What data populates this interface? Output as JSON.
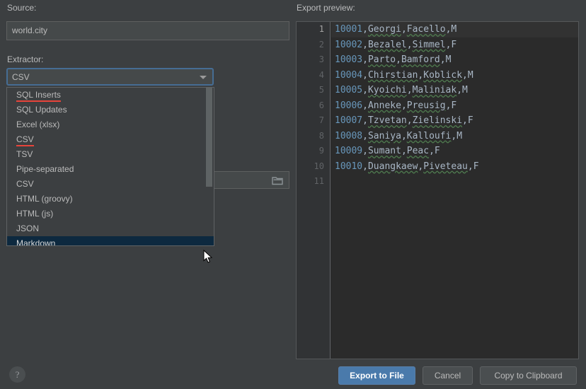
{
  "left_pane": {
    "source_label": "Source:",
    "source_value": "world.city",
    "extractor_label": "Extractor:",
    "extractor_value": "CSV",
    "output_path_value": "",
    "folder_icon": "folder-icon",
    "dropdown_arrow_icon": "chevron-down-icon"
  },
  "extractor_dropdown": {
    "items": [
      {
        "label": "SQL Inserts",
        "underlined": true,
        "selected": false
      },
      {
        "label": "SQL Updates",
        "underlined": false,
        "selected": false
      },
      {
        "label": "Excel (xlsx)",
        "underlined": false,
        "selected": false
      },
      {
        "label": "CSV",
        "underlined": true,
        "selected": false
      },
      {
        "label": "TSV",
        "underlined": false,
        "selected": false
      },
      {
        "label": "Pipe-separated",
        "underlined": false,
        "selected": false
      },
      {
        "label": "CSV",
        "underlined": false,
        "selected": false
      },
      {
        "label": "HTML (groovy)",
        "underlined": false,
        "selected": false
      },
      {
        "label": "HTML (js)",
        "underlined": false,
        "selected": false
      },
      {
        "label": "JSON",
        "underlined": false,
        "selected": false
      },
      {
        "label": "Markdown",
        "underlined": false,
        "selected": true
      }
    ]
  },
  "right_pane": {
    "preview_label": "Export preview:",
    "lines": [
      {
        "n": "1",
        "id": "10001",
        "first": "Georgi",
        "last": "Facello",
        "sex": "M"
      },
      {
        "n": "2",
        "id": "10002",
        "first": "Bezalel",
        "last": "Simmel",
        "sex": "F"
      },
      {
        "n": "3",
        "id": "10003",
        "first": "Parto",
        "last": "Bamford",
        "sex": "M"
      },
      {
        "n": "4",
        "id": "10004",
        "first": "Chirstian",
        "last": "Koblick",
        "sex": "M"
      },
      {
        "n": "5",
        "id": "10005",
        "first": "Kyoichi",
        "last": "Maliniak",
        "sex": "M"
      },
      {
        "n": "6",
        "id": "10006",
        "first": "Anneke",
        "last": "Preusig",
        "sex": "F"
      },
      {
        "n": "7",
        "id": "10007",
        "first": "Tzvetan",
        "last": "Zielinski",
        "sex": "F"
      },
      {
        "n": "8",
        "id": "10008",
        "first": "Saniya",
        "last": "Kalloufi",
        "sex": "M"
      },
      {
        "n": "9",
        "id": "10009",
        "first": "Sumant",
        "last": "Peac",
        "sex": "F"
      },
      {
        "n": "10",
        "id": "10010",
        "first": "Duangkaew",
        "last": "Piveteau",
        "sex": "F"
      },
      {
        "n": "11",
        "id": "",
        "first": "",
        "last": "",
        "sex": ""
      }
    ]
  },
  "footer": {
    "help_label": "?",
    "export_label": "Export to File",
    "cancel_label": "Cancel",
    "clipboard_label": "Copy to Clipboard"
  },
  "colors": {
    "background": "#3c3f41",
    "editor_background": "#2b2b2b",
    "accent_blue": "#4a7aab",
    "focus_border": "#466d94",
    "selection_blue": "#0d293f",
    "error_underline": "#e8443a",
    "spellcheck_underline": "#4e7a4e",
    "number_token": "#6897bb",
    "text_token": "#a9b7c6"
  }
}
